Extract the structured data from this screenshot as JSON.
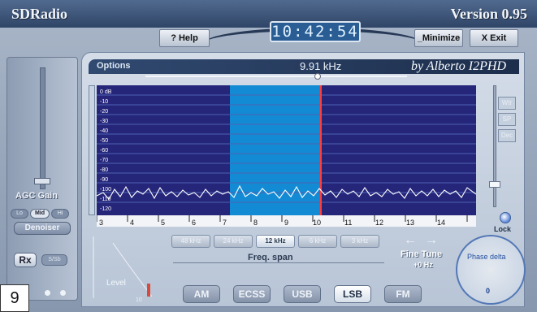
{
  "window": {
    "title": "SDRadio",
    "version": "Version 0.95"
  },
  "clock": "10:42:54",
  "toolbar": {
    "help_label": "? Help",
    "minimize_label": "_Minimize",
    "exit_label": "X Exit"
  },
  "left_panel": {
    "agc_label": "AGC Gain",
    "agc_levels": [
      "Lo",
      "Mid",
      "Hi"
    ],
    "denoiser_label": "Denoiser",
    "rx_label": "Rx",
    "sub_label": "S/Sb"
  },
  "corner_badge": "9",
  "main": {
    "options_label": "Options",
    "frequency": "9.91 kHz",
    "author": "by Alberto I2PHD",
    "db_top": "0 dB",
    "db_labels": [
      "-10",
      "-20",
      "-30",
      "-40",
      "-50",
      "-60",
      "-70",
      "-80",
      "-90",
      "-100",
      "-110",
      "-120"
    ],
    "x_ticks": [
      "3",
      "4",
      "5",
      "6",
      "7",
      "8",
      "9",
      "10",
      "11",
      "12",
      "13",
      "14"
    ],
    "side_buttons": [
      "Wtr",
      "SP",
      "Dec"
    ],
    "lock_label": "Lock",
    "span_buttons": [
      "48 kHz",
      "24 kHz",
      "12 kHz",
      "6 kHz",
      "3 kHz"
    ],
    "active_span": "12 kHz",
    "freq_span_label": "Freq. span",
    "fine_tune_label": "Fine Tune",
    "fine_tune_value": "+0 Hz",
    "phase_label": "Phase delta",
    "phase_value": "0",
    "level_label": "Level",
    "level_marks": [
      "10"
    ],
    "modes": [
      "AM",
      "ECSS",
      "USB",
      "LSB",
      "FM"
    ],
    "active_mode": "LSB"
  }
}
